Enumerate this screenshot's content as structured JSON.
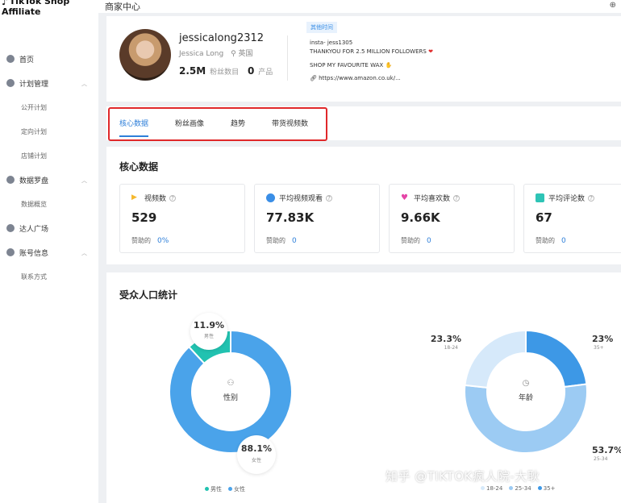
{
  "app": {
    "logo_line1": "TikTok Shop",
    "logo_line2": "Affiliate",
    "title": "商家中心"
  },
  "sidebar": {
    "items": [
      {
        "label": "首页"
      },
      {
        "label": "计划管理"
      },
      {
        "label": "公开计划"
      },
      {
        "label": "定向计划"
      },
      {
        "label": "店铺计划"
      },
      {
        "label": "数据罗盘"
      },
      {
        "label": "数据概览"
      },
      {
        "label": "达人广场"
      },
      {
        "label": "账号信息"
      },
      {
        "label": "联系方式"
      }
    ]
  },
  "profile": {
    "username": "jessicalong2312",
    "realname": "Jessica Long",
    "country": "英国",
    "followers_value": "2.5M",
    "followers_label": "粉丝数目",
    "products_value": "0",
    "products_label": "产品",
    "bio_tag": "其他时间",
    "bio_line1": "insta- jess1305",
    "bio_line2": "THANKYOU FOR 2.5 MILLION FOLLOWERS",
    "bio_line3": "SHOP MY FAVOURITE WAX",
    "bio_link": "https://www.amazon.co.uk/..."
  },
  "tabs": [
    {
      "label": "核心数据",
      "active": true
    },
    {
      "label": "粉丝画像"
    },
    {
      "label": "趋势"
    },
    {
      "label": "带货视频数"
    }
  ],
  "core": {
    "title": "核心数据",
    "metrics": [
      {
        "label": "视频数",
        "value": "529",
        "foot_label": "赞助的",
        "foot_value": "0%",
        "icon": "play-icon",
        "color": "#f5b82e"
      },
      {
        "label": "平均视频观看",
        "value": "77.83K",
        "foot_label": "赞助的",
        "foot_value": "0",
        "icon": "eye-icon",
        "color": "#3a8ee6"
      },
      {
        "label": "平均喜欢数",
        "value": "9.66K",
        "foot_label": "赞助的",
        "foot_value": "0",
        "icon": "heart-icon",
        "color": "#e545a7"
      },
      {
        "label": "平均评论数",
        "value": "67",
        "foot_label": "赞助的",
        "foot_value": "0",
        "icon": "comment-icon",
        "color": "#2ec4b6"
      }
    ]
  },
  "audience": {
    "title": "受众人口统计",
    "gender": {
      "center_label": "性别",
      "male_pct": "11.9%",
      "male_label": "男性",
      "male_fraction": 0.119,
      "female_pct": "88.1%",
      "female_label": "女性",
      "legend": [
        "男性",
        "女性"
      ],
      "colors": {
        "male": "#21c2b0",
        "female": "#4aa3ea"
      }
    },
    "age": {
      "center_label": "年龄",
      "segments": [
        {
          "label": "18-24",
          "pct": "23.3%",
          "fraction": 0.233,
          "color": "#d6e9fa"
        },
        {
          "label": "25-34",
          "pct": "53.7%",
          "fraction": 0.537,
          "color": "#9ccbf3"
        },
        {
          "label": "35+",
          "pct": "23%",
          "fraction": 0.23,
          "color": "#3d98e6"
        }
      ],
      "legend": [
        "18-24",
        "25-34",
        "35+"
      ]
    }
  },
  "watermark": "知乎 @TIKTOK疯人院-大耿"
}
